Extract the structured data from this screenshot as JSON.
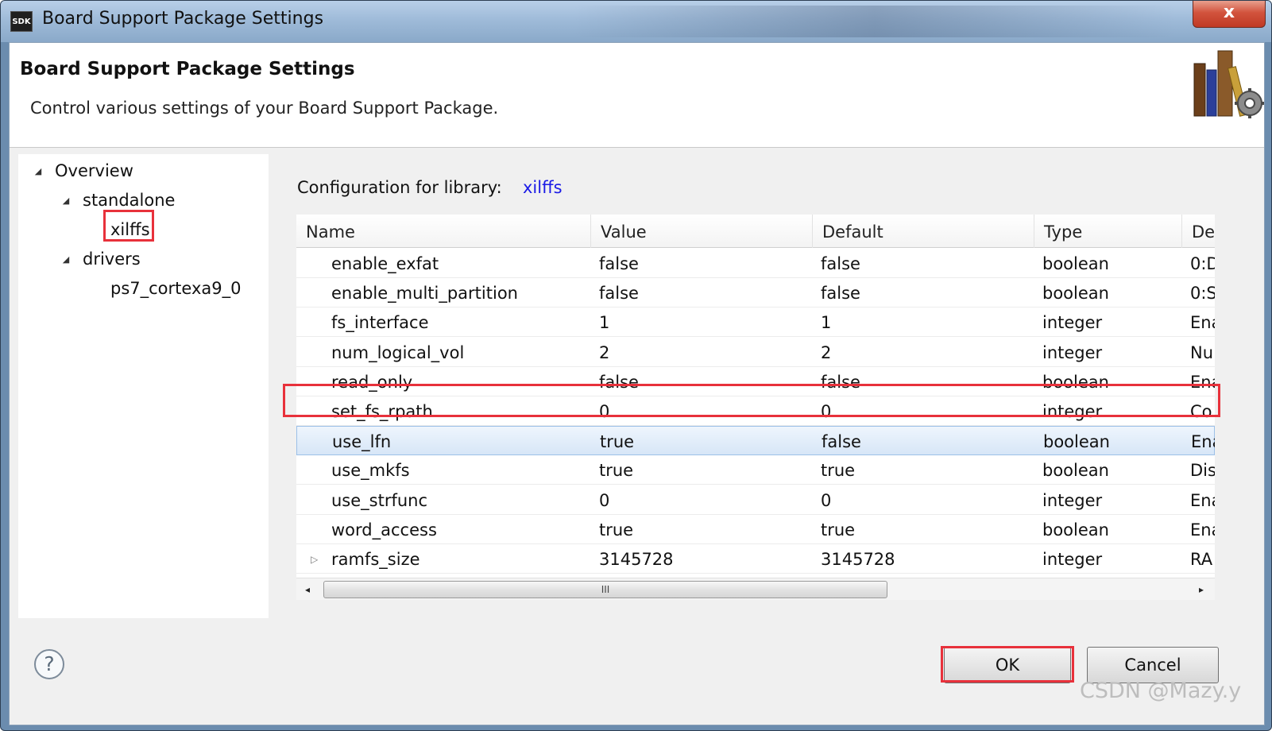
{
  "window": {
    "app_icon_text": "SDK",
    "title": "Board Support Package Settings",
    "close_label": "x"
  },
  "header": {
    "title": "Board Support Package Settings",
    "description": "Control various settings of your Board Support Package.",
    "graphic": "books-gear-icon"
  },
  "tree": {
    "items": [
      {
        "label": "Overview",
        "expanded": true
      },
      {
        "label": "standalone",
        "expanded": true
      },
      {
        "label": "xilffs",
        "selected": true
      },
      {
        "label": "drivers",
        "expanded": true
      },
      {
        "label": "ps7_cortexa9_0"
      }
    ]
  },
  "config": {
    "label": "Configuration for library:",
    "library": "xilffs"
  },
  "table": {
    "columns": [
      "Name",
      "Value",
      "Default",
      "Type",
      "De"
    ],
    "rows": [
      {
        "name": "enable_exfat",
        "value": "false",
        "default": "false",
        "type": "boolean",
        "desc": "0:D"
      },
      {
        "name": "enable_multi_partition",
        "value": "false",
        "default": "false",
        "type": "boolean",
        "desc": "0:S"
      },
      {
        "name": "fs_interface",
        "value": "1",
        "default": "1",
        "type": "integer",
        "desc": "Ena"
      },
      {
        "name": "num_logical_vol",
        "value": "2",
        "default": "2",
        "type": "integer",
        "desc": "Nu"
      },
      {
        "name": "read_only",
        "value": "false",
        "default": "false",
        "type": "boolean",
        "desc": "Ena"
      },
      {
        "name": "set_fs_rpath",
        "value": "0",
        "default": "0",
        "type": "integer",
        "desc": "Co"
      },
      {
        "name": "use_lfn",
        "value": "true",
        "default": "false",
        "type": "boolean",
        "desc": "Ena",
        "selected": true
      },
      {
        "name": "use_mkfs",
        "value": "true",
        "default": "true",
        "type": "boolean",
        "desc": "Dis"
      },
      {
        "name": "use_strfunc",
        "value": "0",
        "default": "0",
        "type": "integer",
        "desc": "Ena"
      },
      {
        "name": "word_access",
        "value": "true",
        "default": "true",
        "type": "boolean",
        "desc": "Ena"
      },
      {
        "name": "ramfs_size",
        "value": "3145728",
        "default": "3145728",
        "type": "integer",
        "desc": "RA",
        "expandable": true
      }
    ]
  },
  "scrollbar": {
    "left_arrow": "◂",
    "right_arrow": "▸",
    "grip": "III"
  },
  "buttons": {
    "help": "?",
    "ok": "OK",
    "cancel": "Cancel"
  },
  "watermark": "CSDN @Mazy.y",
  "colors": {
    "highlight_box": "#e8313b",
    "library_link": "#1a1ae6",
    "selected_row": "#d7e6f7"
  }
}
